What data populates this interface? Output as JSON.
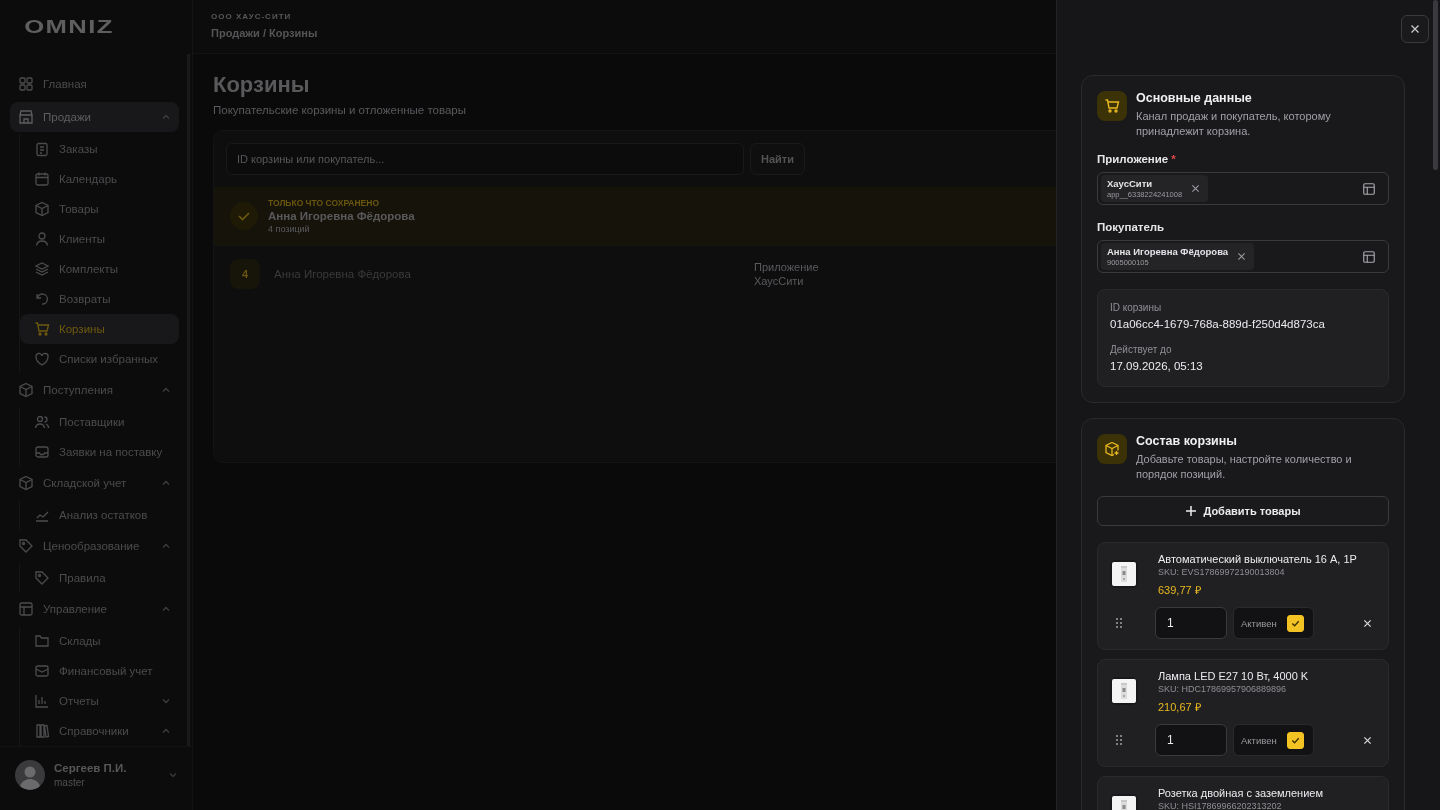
{
  "logo": "OMNIZ",
  "header": {
    "org": "ООО ХАУС-СИТИ",
    "breadcrumb": "Продажи / Корзины"
  },
  "sidebar": {
    "items": [
      {
        "label": "Главная",
        "selected": false
      },
      {
        "label": "Продажи",
        "selected": true,
        "expanded": true,
        "children": [
          {
            "label": "Заказы",
            "selected": false
          },
          {
            "label": "Календарь",
            "selected": false
          },
          {
            "label": "Товары",
            "selected": false
          },
          {
            "label": "Клиенты",
            "selected": false
          },
          {
            "label": "Комплекты",
            "selected": false
          },
          {
            "label": "Возвраты",
            "selected": false
          },
          {
            "label": "Корзины",
            "selected": true
          },
          {
            "label": "Списки избранных",
            "selected": false
          }
        ]
      },
      {
        "label": "Поступления",
        "selected": false,
        "expanded": true,
        "children": [
          {
            "label": "Поставщики",
            "selected": false
          },
          {
            "label": "Заявки на поставку",
            "selected": false
          }
        ]
      },
      {
        "label": "Складской учет",
        "selected": false,
        "expanded": true,
        "children": [
          {
            "label": "Анализ остатков",
            "selected": false
          }
        ]
      },
      {
        "label": "Ценообразование",
        "selected": false,
        "expanded": true,
        "children": [
          {
            "label": "Правила",
            "selected": false
          }
        ]
      },
      {
        "label": "Управление",
        "selected": false,
        "expanded": true,
        "children": [
          {
            "label": "Склады",
            "selected": false
          },
          {
            "label": "Финансовый учет",
            "selected": false
          },
          {
            "label": "Отчеты",
            "selected": false,
            "expanded": false
          },
          {
            "label": "Справочники",
            "selected": false,
            "expanded": true
          }
        ]
      }
    ]
  },
  "user": {
    "name": "Сергеев П.И.",
    "role": "master"
  },
  "page": {
    "title": "Корзины",
    "subtitle": "Покупательские корзины и отложенные товары",
    "search": {
      "placeholder": "ID корзины или покупатель..."
    },
    "search_button": "Найти",
    "rows": [
      {
        "kind": "saved",
        "status": "ТОЛЬКО ЧТО СОХРАНЕНО",
        "name": "Анна Игоревна Фёдорова",
        "count": "4 позиций"
      },
      {
        "kind": "cart",
        "badge": "4",
        "name": "Анна Игоревна Фёдорова",
        "app_label": "Приложение",
        "app": "ХаусСити"
      }
    ]
  },
  "drawer": {
    "main": {
      "title": "Основные данные",
      "description": "Канал продаж и покупатель, которому принадлежит корзина.",
      "fields": [
        {
          "label": "Приложение",
          "required_mark": "*",
          "chip_title": "ХаусСити",
          "chip_sub": "app__6338224241008"
        },
        {
          "label": "Покупатель",
          "chip_title": "Анна Игоревна Фёдорова",
          "chip_sub": "9005000105"
        }
      ],
      "info": [
        {
          "label": "ID корзины",
          "value": "01a06cc4-1679-768a-889d-f250d4d873ca"
        },
        {
          "label": "Действует до",
          "value": "17.09.2026, 05:13"
        }
      ]
    },
    "items": {
      "title": "Состав корзины",
      "description": "Добавьте товары, настройте количество и порядок позиций.",
      "add_button": "Добавить товары",
      "products": [
        {
          "name": "Автоматический выключатель 16 А, 1P",
          "sku": "SKU: EVS17869972190013804",
          "price": "639,77 ₽",
          "quantity": "1",
          "active_label": "Активен",
          "active": true
        },
        {
          "name": "Лампа LED E27 10 Вт, 4000 K",
          "sku": "SKU: HDC17869957906889896",
          "price": "210,67 ₽",
          "quantity": "1",
          "active_label": "Активен",
          "active": true
        },
        {
          "name": "Розетка двойная с заземлением",
          "sku": "SKU: HSI17869966202313202"
        }
      ]
    }
  }
}
